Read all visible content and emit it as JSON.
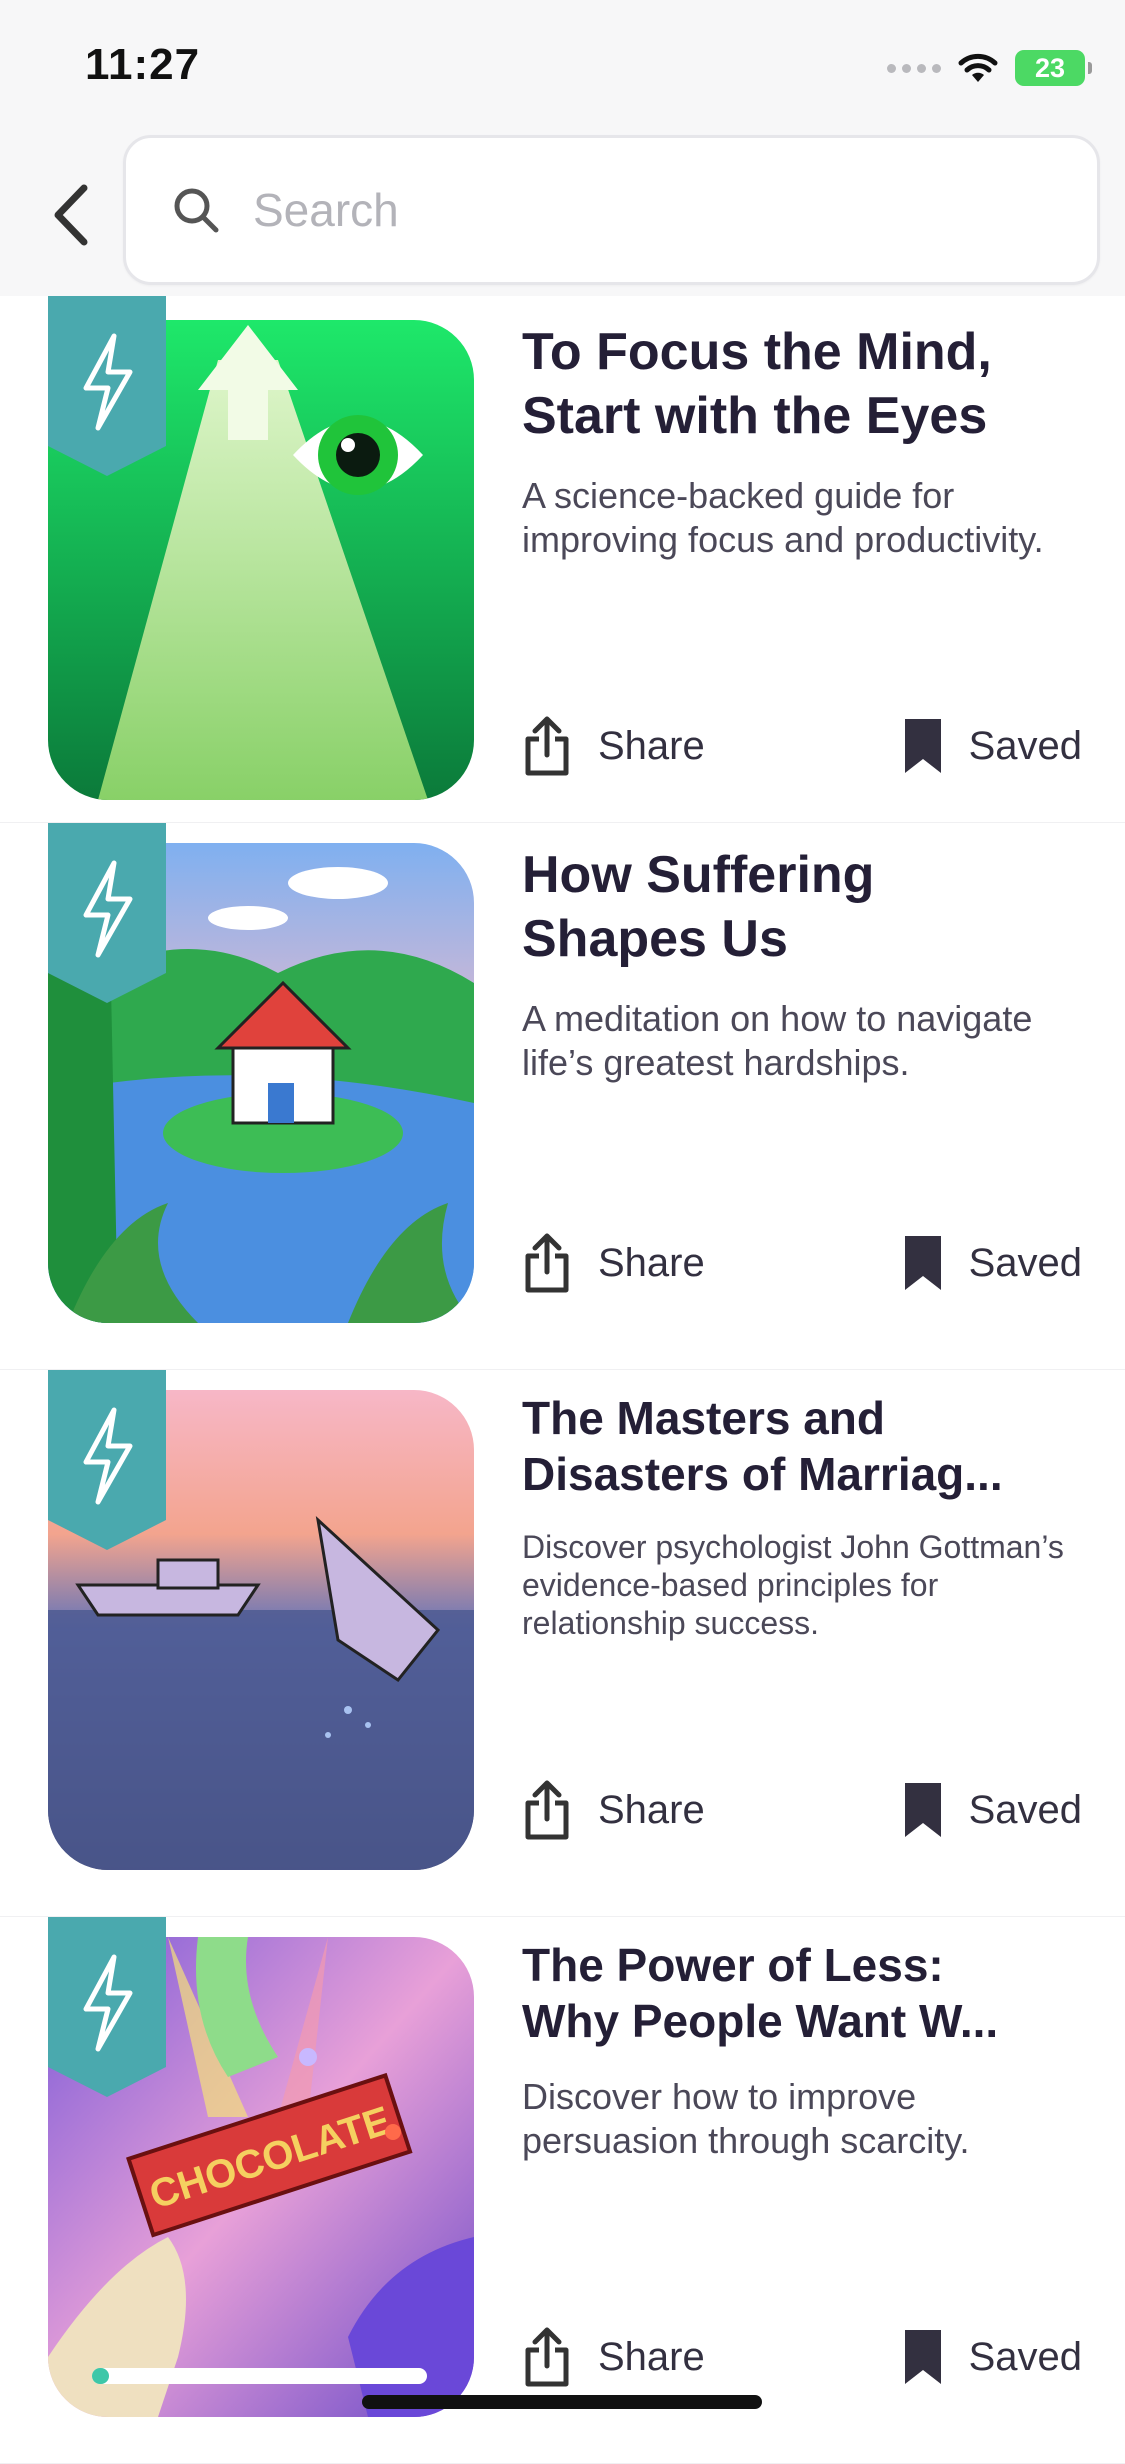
{
  "status_bar": {
    "time": "11:27",
    "battery": "23"
  },
  "search": {
    "placeholder": "Search",
    "value": ""
  },
  "cards": [
    {
      "title_line1": "To Focus the Mind,",
      "title_line2": "Start with the Eyes",
      "description": "A science-backed guide for improving focus and productivity.",
      "share_label": "Share",
      "saved_label": "Saved"
    },
    {
      "title_line1": "How Suffering",
      "title_line2": "Shapes Us",
      "description": "A meditation on how to navigate life’s greatest hardships.",
      "share_label": "Share",
      "saved_label": "Saved"
    },
    {
      "title_line1": "The Masters and",
      "title_line2": "Disasters of Marriag...",
      "description": "Discover psychologist John Gottman’s evidence-based principles for relationship success.",
      "share_label": "Share",
      "saved_label": "Saved"
    },
    {
      "title_line1": "The Power of Less:",
      "title_line2": "Why People Want W...",
      "description": "Discover how to improve persuasion through scarcity.",
      "share_label": "Share",
      "saved_label": "Saved",
      "cover_text": "CHOCOLATE",
      "progress": 0.05
    }
  ],
  "colors": {
    "accent": "#3ec7a8",
    "badge": "#4aa9ae",
    "title": "#241f36"
  }
}
